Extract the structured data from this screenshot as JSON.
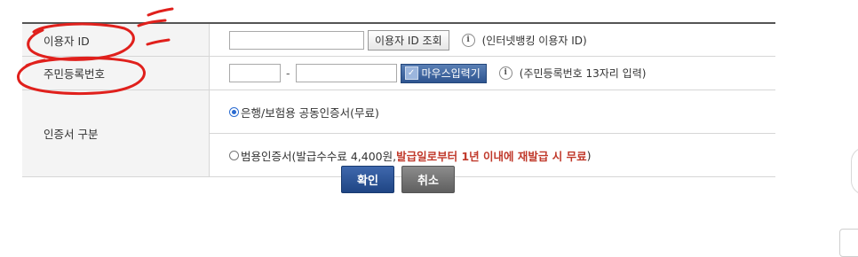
{
  "fields": {
    "user_id_label": "이용자 ID",
    "user_id_value": "",
    "user_id_lookup_button": "이용자 ID 조회",
    "user_id_help": "(인터넷뱅킹 이용자 ID)",
    "rrn_label": "주민등록번호",
    "rrn_front_value": "",
    "rrn_back_value": "",
    "rrn_dash": "-",
    "mouse_input_button": "마우스입력기",
    "rrn_help": "(주민등록번호 13자리 입력)",
    "info_glyph": "i"
  },
  "certificate": {
    "label": "인증서 구분",
    "options": [
      {
        "text": "은행/보험용 공동인증서(무료)",
        "selected": true
      },
      {
        "text_before": "범용인증서(발급수수료 4,400원, ",
        "text_emph": "발급일로부터 1년 이내에 재발급 시 무료",
        "text_after": ")",
        "selected": false
      }
    ]
  },
  "actions": {
    "confirm": "확인",
    "cancel": "취소"
  },
  "colors": {
    "accent_blue": "#2e5590",
    "emphasis_red": "#c0392b",
    "annotation_red": "#e0201c"
  }
}
